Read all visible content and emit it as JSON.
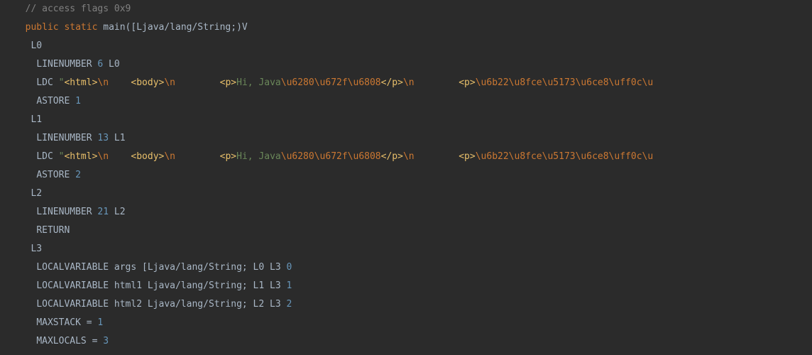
{
  "lines": [
    {
      "indent": "  ",
      "tokens": [
        {
          "cls": "comment",
          "text": "// access flags 0x9"
        }
      ]
    },
    {
      "indent": "  ",
      "tokens": [
        {
          "cls": "keyword",
          "text": "public"
        },
        {
          "cls": "text",
          "text": " "
        },
        {
          "cls": "keyword",
          "text": "static"
        },
        {
          "cls": "text",
          "text": " main([Ljava/lang/String;)V"
        }
      ]
    },
    {
      "indent": "   ",
      "tokens": [
        {
          "cls": "text",
          "text": "L0"
        }
      ]
    },
    {
      "indent": "    ",
      "tokens": [
        {
          "cls": "text",
          "text": "LINENUMBER "
        },
        {
          "cls": "number",
          "text": "6"
        },
        {
          "cls": "text",
          "text": " L0"
        }
      ]
    },
    {
      "indent": "    ",
      "tokens": [
        {
          "cls": "text",
          "text": "LDC "
        },
        {
          "cls": "string",
          "text": "\""
        },
        {
          "cls": "tag",
          "text": "<html>"
        },
        {
          "cls": "escape",
          "text": "\\n"
        },
        {
          "cls": "string",
          "text": "    "
        },
        {
          "cls": "tag",
          "text": "<body>"
        },
        {
          "cls": "escape",
          "text": "\\n"
        },
        {
          "cls": "string",
          "text": "        "
        },
        {
          "cls": "tag",
          "text": "<p>"
        },
        {
          "cls": "string",
          "text": "Hi, Java"
        },
        {
          "cls": "escape",
          "text": "\\u6280\\u672f\\u6808"
        },
        {
          "cls": "tag",
          "text": "</p>"
        },
        {
          "cls": "escape",
          "text": "\\n"
        },
        {
          "cls": "string",
          "text": "        "
        },
        {
          "cls": "tag",
          "text": "<p>"
        },
        {
          "cls": "escape",
          "text": "\\u6b22\\u8fce\\u5173\\u6ce8\\uff0c\\u"
        }
      ]
    },
    {
      "indent": "    ",
      "tokens": [
        {
          "cls": "text",
          "text": "ASTORE "
        },
        {
          "cls": "number",
          "text": "1"
        }
      ]
    },
    {
      "indent": "   ",
      "tokens": [
        {
          "cls": "text",
          "text": "L1"
        }
      ]
    },
    {
      "indent": "    ",
      "tokens": [
        {
          "cls": "text",
          "text": "LINENUMBER "
        },
        {
          "cls": "number",
          "text": "13"
        },
        {
          "cls": "text",
          "text": " L1"
        }
      ]
    },
    {
      "indent": "    ",
      "tokens": [
        {
          "cls": "text",
          "text": "LDC "
        },
        {
          "cls": "string",
          "text": "\""
        },
        {
          "cls": "tag",
          "text": "<html>"
        },
        {
          "cls": "escape",
          "text": "\\n"
        },
        {
          "cls": "string",
          "text": "    "
        },
        {
          "cls": "tag",
          "text": "<body>"
        },
        {
          "cls": "escape",
          "text": "\\n"
        },
        {
          "cls": "string",
          "text": "        "
        },
        {
          "cls": "tag",
          "text": "<p>"
        },
        {
          "cls": "string",
          "text": "Hi, Java"
        },
        {
          "cls": "escape",
          "text": "\\u6280\\u672f\\u6808"
        },
        {
          "cls": "tag",
          "text": "</p>"
        },
        {
          "cls": "escape",
          "text": "\\n"
        },
        {
          "cls": "string",
          "text": "        "
        },
        {
          "cls": "tag",
          "text": "<p>"
        },
        {
          "cls": "escape",
          "text": "\\u6b22\\u8fce\\u5173\\u6ce8\\uff0c\\u"
        }
      ]
    },
    {
      "indent": "    ",
      "tokens": [
        {
          "cls": "text",
          "text": "ASTORE "
        },
        {
          "cls": "number",
          "text": "2"
        }
      ]
    },
    {
      "indent": "   ",
      "tokens": [
        {
          "cls": "text",
          "text": "L2"
        }
      ]
    },
    {
      "indent": "    ",
      "tokens": [
        {
          "cls": "text",
          "text": "LINENUMBER "
        },
        {
          "cls": "number",
          "text": "21"
        },
        {
          "cls": "text",
          "text": " L2"
        }
      ]
    },
    {
      "indent": "    ",
      "tokens": [
        {
          "cls": "text",
          "text": "RETURN"
        }
      ]
    },
    {
      "indent": "   ",
      "tokens": [
        {
          "cls": "text",
          "text": "L3"
        }
      ]
    },
    {
      "indent": "    ",
      "tokens": [
        {
          "cls": "text",
          "text": "LOCALVARIABLE args [Ljava/lang/String; L0 L3 "
        },
        {
          "cls": "number",
          "text": "0"
        }
      ]
    },
    {
      "indent": "    ",
      "tokens": [
        {
          "cls": "text",
          "text": "LOCALVARIABLE html1 Ljava/lang/String; L1 L3 "
        },
        {
          "cls": "number",
          "text": "1"
        }
      ]
    },
    {
      "indent": "    ",
      "tokens": [
        {
          "cls": "text",
          "text": "LOCALVARIABLE html2 Ljava/lang/String; L2 L3 "
        },
        {
          "cls": "number",
          "text": "2"
        }
      ]
    },
    {
      "indent": "    ",
      "tokens": [
        {
          "cls": "text",
          "text": "MAXSTACK = "
        },
        {
          "cls": "number",
          "text": "1"
        }
      ]
    },
    {
      "indent": "    ",
      "tokens": [
        {
          "cls": "text",
          "text": "MAXLOCALS = "
        },
        {
          "cls": "number",
          "text": "3"
        }
      ]
    }
  ]
}
